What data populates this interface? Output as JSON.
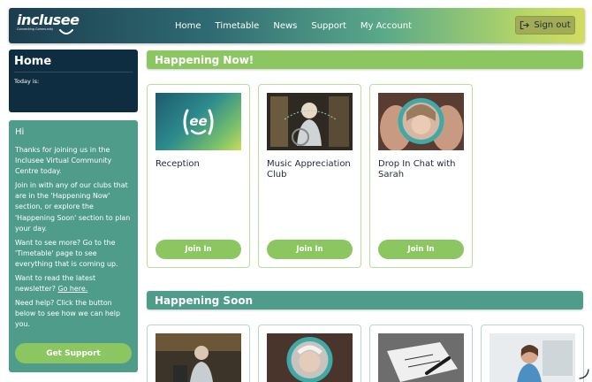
{
  "header": {
    "logo_text": "inclusee",
    "logo_tagline": "Connecting Community",
    "nav": [
      "Home",
      "Timetable",
      "News",
      "Support",
      "My Account"
    ],
    "signout_label": "Sign out"
  },
  "sidebar": {
    "home_title": "Home",
    "today_label": "Today is:",
    "greeting": "Hi",
    "paragraphs": [
      "Thanks for joining us in the Inclusee Virtual Community Centre today.",
      "Join in with any of our clubs that are in the 'Happening Now' section, or explore the 'Happening Soon' section to plan your day.",
      "Want to see more? Go to the 'Timetable' page to see everything that is coming up.",
      "Want to read the latest newsletter?",
      "Need help? Click the button below to see how we can help you."
    ],
    "newsletter_link": "Go here.",
    "support_button": "Get Support"
  },
  "happening_now": {
    "heading": "Happening Now!",
    "cards": [
      {
        "title": "Reception",
        "button": "Join In",
        "icon": "ee-logo-icon"
      },
      {
        "title": "Music Appreciation Club",
        "button": "Join In"
      },
      {
        "title": "Drop In Chat with Sarah",
        "button": "Join In"
      }
    ]
  },
  "happening_soon": {
    "heading": "Happening Soon"
  },
  "colors": {
    "green": "#8cc660",
    "teal": "#4f9c8a",
    "navy": "#0f2d40"
  }
}
